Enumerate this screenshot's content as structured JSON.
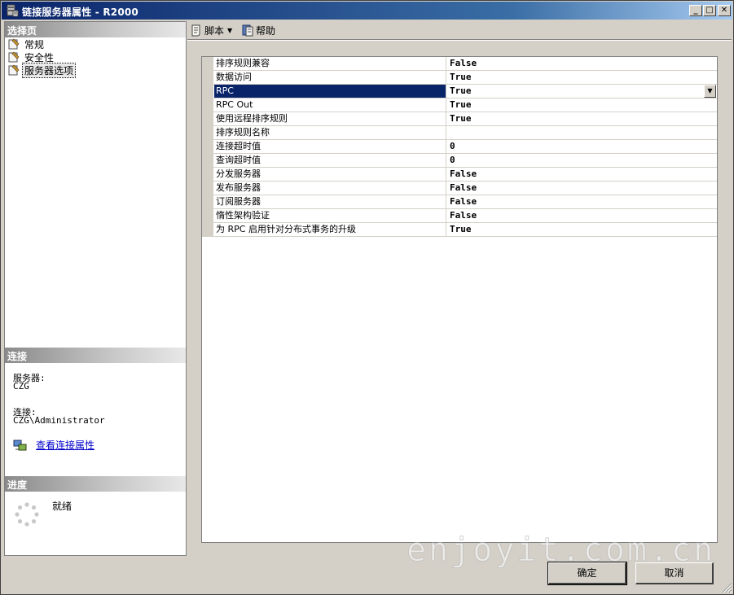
{
  "window": {
    "title": "链接服务器属性 - R2000"
  },
  "left": {
    "select_header": "选择页",
    "nav": [
      {
        "label": "常规"
      },
      {
        "label": "安全性"
      },
      {
        "label": "服务器选项"
      }
    ],
    "connection_header": "连接",
    "server_label": "服务器:",
    "server_value": "CZG",
    "connection_label": "连接:",
    "connection_value": "CZG\\Administrator",
    "view_link": "查看连接属性",
    "progress_header": "进度",
    "progress_status": "就绪"
  },
  "toolbar": {
    "script_label": "脚本",
    "help_label": "帮助"
  },
  "grid": {
    "rows": [
      {
        "name": "排序规则兼容",
        "value": "False"
      },
      {
        "name": "数据访问",
        "value": "True"
      },
      {
        "name": "RPC",
        "value": "True"
      },
      {
        "name": "RPC Out",
        "value": "True"
      },
      {
        "name": "使用远程排序规则",
        "value": "True"
      },
      {
        "name": "排序规则名称",
        "value": ""
      },
      {
        "name": "连接超时值",
        "value": "0"
      },
      {
        "name": "查询超时值",
        "value": "0"
      },
      {
        "name": "分发服务器",
        "value": "False"
      },
      {
        "name": "发布服务器",
        "value": "False"
      },
      {
        "name": "订阅服务器",
        "value": "False"
      },
      {
        "name": "惰性架构验证",
        "value": "False"
      },
      {
        "name": "为 RPC 启用针对分布式事务的升级",
        "value": "True"
      }
    ]
  },
  "buttons": {
    "ok": "确定",
    "cancel": "取消"
  },
  "watermark": "enjoyit.com.cn"
}
